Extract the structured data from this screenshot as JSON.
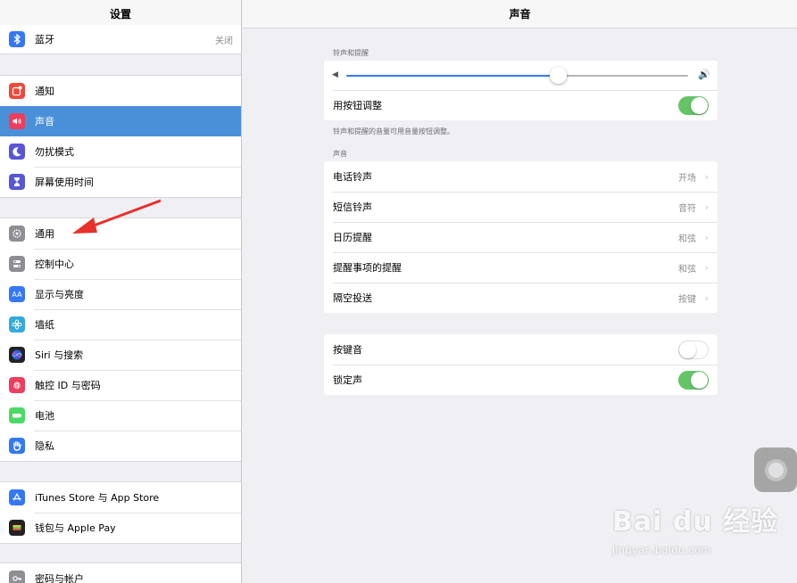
{
  "sidebar": {
    "title": "设置",
    "bluetooth": {
      "label": "蓝牙",
      "value": "关闭",
      "color": "#3478f6"
    },
    "group1": [
      {
        "label": "通知",
        "icon": "notifications-icon",
        "color": "#ee4a3c"
      },
      {
        "label": "声音",
        "icon": "sound-icon",
        "color": "#ee3d5d",
        "selected": true
      },
      {
        "label": "勿扰模式",
        "icon": "moon-icon",
        "color": "#5856d6"
      },
      {
        "label": "屏幕使用时间",
        "icon": "hourglass-icon",
        "color": "#5856d6"
      }
    ],
    "group2": [
      {
        "label": "通用",
        "icon": "gear-icon",
        "color": "#8e8e93"
      },
      {
        "label": "控制中心",
        "icon": "control-center-icon",
        "color": "#8e8e93"
      },
      {
        "label": "显示与亮度",
        "icon": "display-brightness-icon",
        "color": "#3478f6"
      },
      {
        "label": "墙纸",
        "icon": "wallpaper-icon",
        "color": "#34aadc"
      },
      {
        "label": "Siri 与搜索",
        "icon": "siri-icon",
        "color": "#222222"
      },
      {
        "label": "触控 ID 与密码",
        "icon": "fingerprint-icon",
        "color": "#ee3d5d"
      },
      {
        "label": "电池",
        "icon": "battery-icon",
        "color": "#4cd964"
      },
      {
        "label": "隐私",
        "icon": "hand-icon",
        "color": "#3478f6"
      }
    ],
    "group3": [
      {
        "label": "iTunes Store 与 App Store",
        "icon": "app-store-icon",
        "color": "#3478f6"
      },
      {
        "label": "钱包与 Apple Pay",
        "icon": "wallet-icon",
        "color": "#222222"
      }
    ],
    "group4": [
      {
        "label": "密码与帐户",
        "icon": "key-icon",
        "color": "#8e8e93"
      }
    ]
  },
  "main": {
    "title": "声音",
    "ringer_section": {
      "header": "铃声和提醒",
      "volume_fraction": 0.62,
      "change_with_buttons": {
        "label": "用按钮调整",
        "on": true
      },
      "footnote": "铃声和提醒的音量可用音量按钮调整。"
    },
    "sounds_section": {
      "header": "声音",
      "rows": [
        {
          "label": "电话铃声",
          "value": "开场"
        },
        {
          "label": "短信铃声",
          "value": "音符"
        },
        {
          "label": "日历提醒",
          "value": "和弦"
        },
        {
          "label": "提醒事项的提醒",
          "value": "和弦"
        },
        {
          "label": "隔空投送",
          "value": "按键"
        }
      ]
    },
    "toggles_section": [
      {
        "label": "按键音",
        "on": false
      },
      {
        "label": "锁定声",
        "on": true
      }
    ]
  },
  "watermark": {
    "main": "Bai du 经验",
    "sub": "jingyan.baidu.com"
  },
  "colors": {
    "accent": "#3478f6",
    "toggle_on": "#65c466",
    "selection": "#4a90d9"
  }
}
